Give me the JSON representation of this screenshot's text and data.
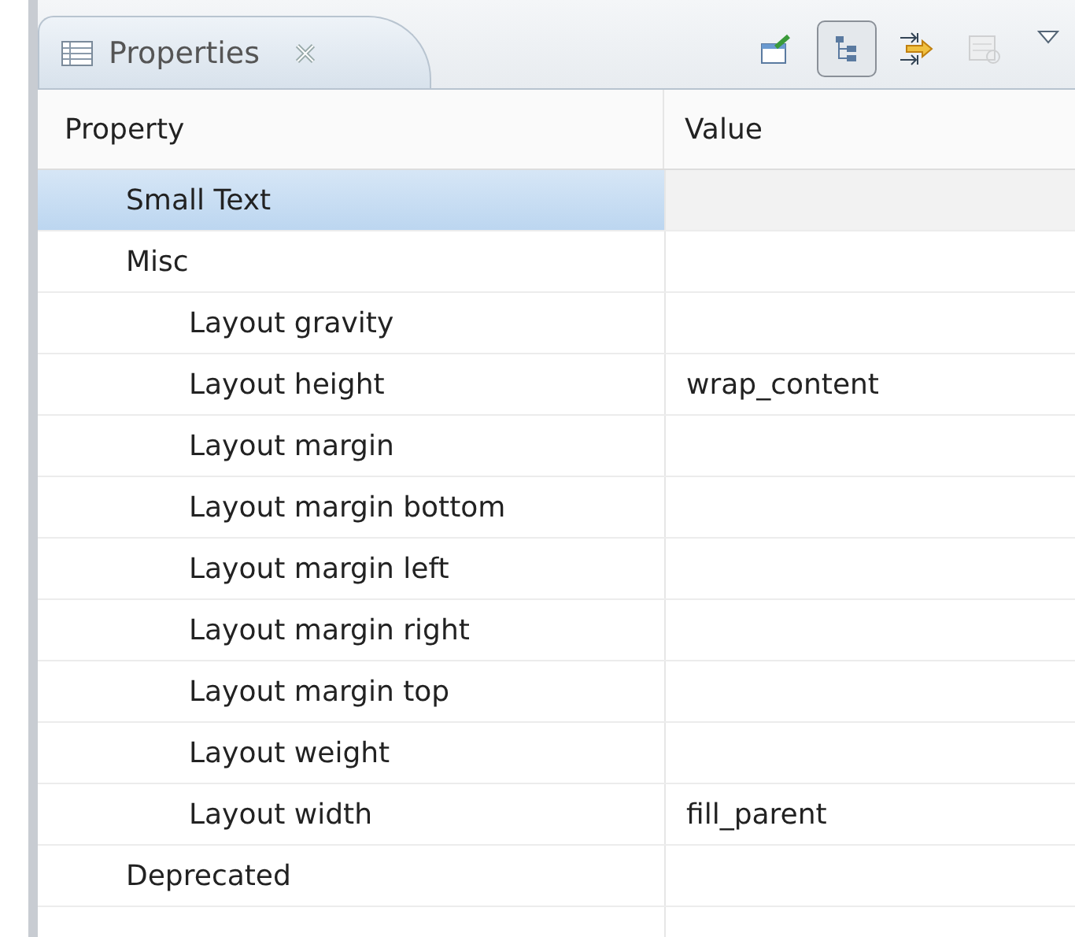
{
  "view_tab": {
    "title": "Properties",
    "selected": true
  },
  "toolbar": [
    {
      "kind": "pin",
      "pressed": false,
      "disabled": false
    },
    {
      "kind": "tree",
      "pressed": true,
      "disabled": false
    },
    {
      "kind": "filter",
      "pressed": false,
      "disabled": false
    },
    {
      "kind": "restore",
      "pressed": false,
      "disabled": true
    }
  ],
  "table": {
    "columns": [
      "Property",
      "Value"
    ],
    "rows": [
      {
        "name": "Small Text",
        "selected": true
      },
      {
        "name": "Misc",
        "selected": false,
        "children": [
          {
            "name": "Layout gravity",
            "selected": false
          },
          {
            "name": "Layout height",
            "value": "wrap_content",
            "selected": false
          },
          {
            "name": "Layout margin",
            "selected": false
          },
          {
            "name": "Layout margin bottom",
            "selected": false
          },
          {
            "name": "Layout margin left",
            "selected": false
          },
          {
            "name": "Layout margin right",
            "selected": false
          },
          {
            "name": "Layout margin top",
            "selected": false
          },
          {
            "name": "Layout weight",
            "selected": false
          },
          {
            "name": "Layout width",
            "value": "fill_parent",
            "selected": false
          }
        ]
      },
      {
        "name": "Deprecated",
        "selected": false
      }
    ]
  }
}
